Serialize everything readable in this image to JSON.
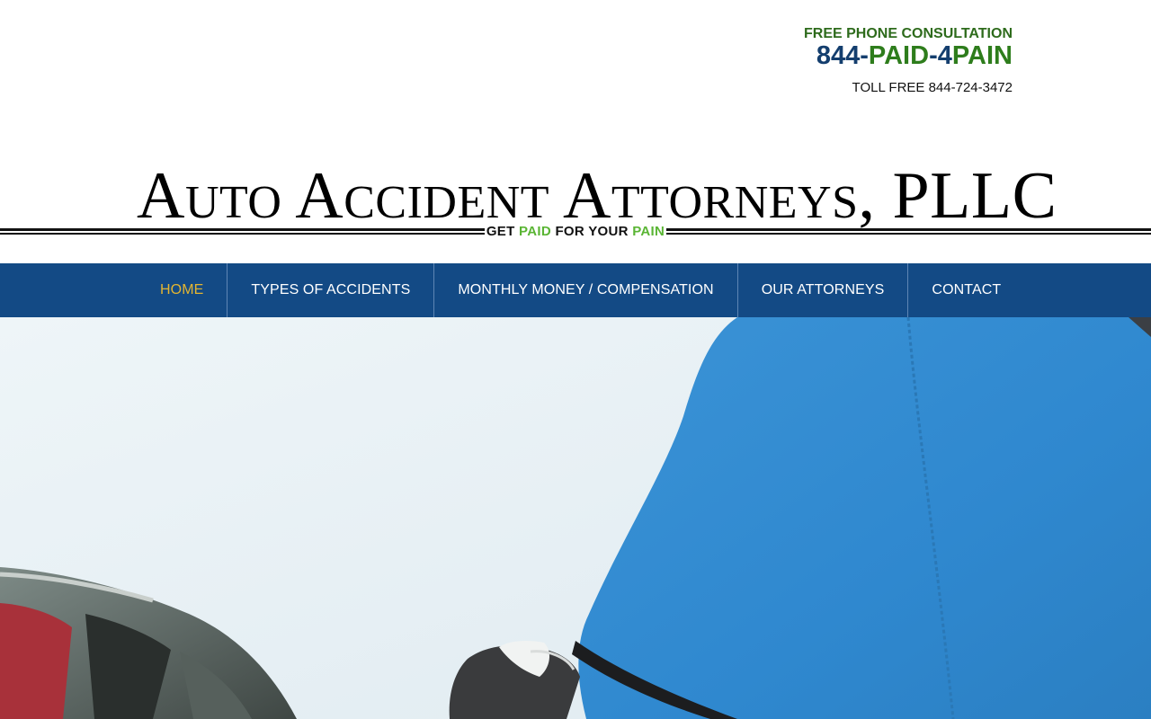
{
  "header": {
    "consultation_label": "FREE PHONE CONSULTATION",
    "phone_part1": "844-",
    "phone_part2": "PAID",
    "phone_part3": "-4",
    "phone_part4": "PAIN",
    "tollfree": "TOLL FREE 844-724-3472"
  },
  "logo": {
    "title": "Auto Accident Attorneys, PLLC",
    "tagline_1": "GET ",
    "tagline_2": "PAID",
    "tagline_3": " FOR YOUR ",
    "tagline_4": "PAIN"
  },
  "nav": {
    "items": [
      {
        "label": "HOME",
        "active": true
      },
      {
        "label": "TYPES OF ACCIDENTS",
        "active": false
      },
      {
        "label": "MONTHLY MONEY / COMPENSATION",
        "active": false
      },
      {
        "label": "OUR ATTORNEYS",
        "active": false
      },
      {
        "label": "CONTACT",
        "active": false
      }
    ]
  },
  "colors": {
    "nav_background": "#134a85",
    "nav_active": "#e3b531",
    "phone_blue": "#143e6e",
    "phone_green": "#2e7d1c",
    "tagline_green": "#5ab534"
  }
}
